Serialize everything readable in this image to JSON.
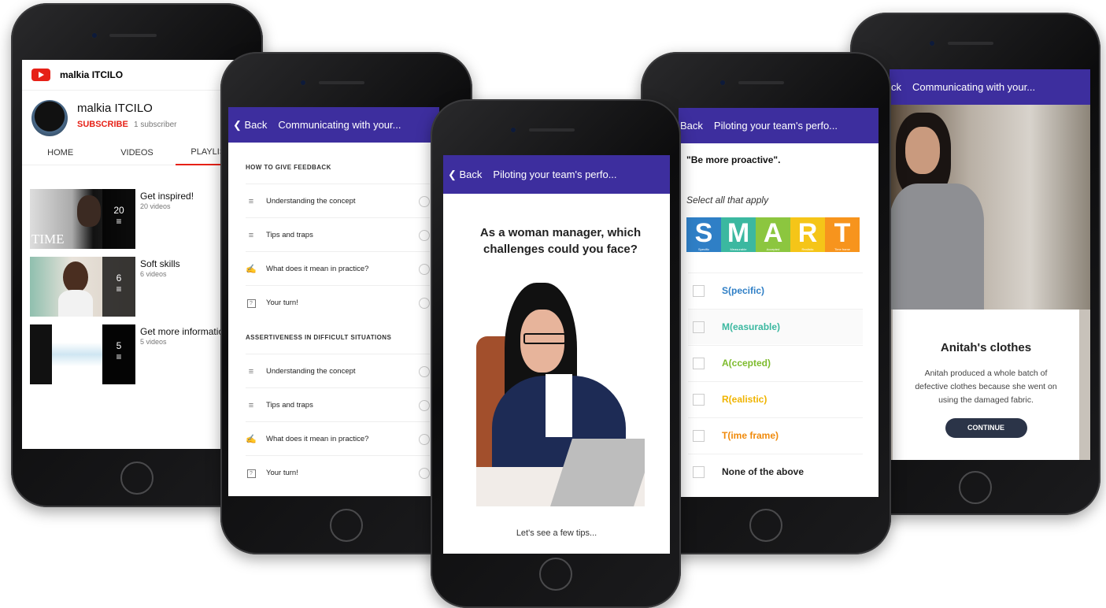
{
  "youtube": {
    "channel_name": "malkia ITCILO",
    "subscribe_label": "SUBSCRIBE",
    "subscriber_count": "1 subscriber",
    "tabs": [
      "HOME",
      "VIDEOS",
      "PLAYLISTS"
    ],
    "playlists": [
      {
        "title": "Get inspired!",
        "count_text": "20 videos",
        "count": "20",
        "thumb_text": "TIME"
      },
      {
        "title": "Soft skills",
        "count_text": "6 videos",
        "count": "6"
      },
      {
        "title": "Get more information",
        "count_text": "5 videos",
        "count": "5"
      }
    ]
  },
  "course_list": {
    "back_label": "Back",
    "title": "Communicating with your...",
    "sections": [
      {
        "heading": "HOW TO GIVE FEEDBACK",
        "items": [
          {
            "label": "Understanding the concept",
            "icon": "lines-icon"
          },
          {
            "label": "Tips and traps",
            "icon": "lines-icon"
          },
          {
            "label": "What does it mean in practice?",
            "icon": "practice-icon"
          },
          {
            "label": "Your turn!",
            "icon": "question-icon"
          }
        ]
      },
      {
        "heading": "ASSERTIVENESS IN DIFFICULT SITUATIONS",
        "items": [
          {
            "label": "Understanding the concept",
            "icon": "lines-icon"
          },
          {
            "label": "Tips and traps",
            "icon": "lines-icon"
          },
          {
            "label": "What does it mean in practice?",
            "icon": "practice-icon"
          },
          {
            "label": "Your turn!",
            "icon": "question-icon"
          }
        ]
      }
    ]
  },
  "question_screen": {
    "back_label": "Back",
    "title": "Piloting your team's perfo...",
    "question": "As a woman manager, which challenges could you face?",
    "footer": "Let's see a few tips..."
  },
  "smart_screen": {
    "back_label": "Back",
    "title": "Piloting your team's perfo...",
    "quote": "\"Be more proactive\".",
    "instruction": "Select all that apply",
    "smart_letters": [
      {
        "letter": "S",
        "word": "Specific",
        "color": "#2f7fc6"
      },
      {
        "letter": "M",
        "word": "Measurable",
        "color": "#3bb8a0"
      },
      {
        "letter": "A",
        "word": "Accepted",
        "color": "#8cc63f"
      },
      {
        "letter": "R",
        "word": "Realistic",
        "color": "#f5c518"
      },
      {
        "letter": "T",
        "word": "Time frame",
        "color": "#f7941d"
      }
    ],
    "options": [
      {
        "label": "S(pecific)",
        "color": "#2f7fc6"
      },
      {
        "label": "M(easurable)",
        "color": "#3bb8a0"
      },
      {
        "label": "A(ccepted)",
        "color": "#7dbb2c"
      },
      {
        "label": "R(ealistic)",
        "color": "#f0b400"
      },
      {
        "label": "T(ime frame)",
        "color": "#f08a0b"
      },
      {
        "label": "None of the above",
        "color": "#222222"
      }
    ]
  },
  "story_screen": {
    "back_label": "Back",
    "title": "Communicating with your...",
    "card_title": "Anitah's clothes",
    "card_body": "Anitah produced a whole batch of defective clothes because she went on using the damaged fabric.",
    "continue_label": "CONTINUE"
  },
  "colors": {
    "header_purple": "#3d2e9e",
    "youtube_red": "#e62117",
    "button_dark": "#2b3448"
  }
}
